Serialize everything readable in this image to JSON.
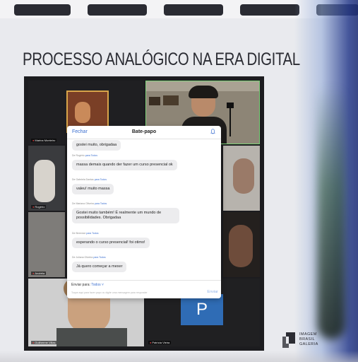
{
  "headline": "PROCESSO ANALÓGICO NA ERA DIGITAL",
  "participants": {
    "marina": "Marina Monteiro",
    "rogerio": "Rogério",
    "andreia": "Andréia",
    "guilherme": "Guilherme Villas",
    "patricia": "Patrícia Vieira",
    "patricia_initial": "P"
  },
  "chat": {
    "close_label": "Fechar",
    "title": "Bate-papo",
    "messages": [
      {
        "meta": "",
        "text": "gostei muito, obrigadaa"
      },
      {
        "meta_from": "De Rogério",
        "meta_to": "para Todos",
        "text": "massa demais quando der fazer um curso presencial ok"
      },
      {
        "meta_from": "De Gabriela Dantas",
        "meta_to": "para Todos",
        "text": "valeu! muito massa"
      },
      {
        "meta_from": "De Mariana Oliveira",
        "meta_to": "para Todos",
        "text": "Gostei muito também! É realmente um mundo de possibilidades. Obrigadaa"
      },
      {
        "meta_from": "De Berenice",
        "meta_to": "para Todos",
        "text": "esperando o curso presencial! foi otimo!"
      },
      {
        "meta_from": "De Juliana Oliveira",
        "meta_to": "para Todos",
        "text": "Já quero começar a mexer"
      }
    ],
    "send_to_label": "Enviar para:",
    "send_to_value": "Todos",
    "input_placeholder": "Toque aqui para fazer papo ou digite uma mensagem para responder",
    "send_label": "Enviar"
  },
  "logo": {
    "line1": "IMAGEM",
    "line2": "BRASIL",
    "line3": "GALERIA"
  },
  "colors": {
    "accent": "#3a6ecf",
    "mic_off": "#e34040",
    "patricia_tile": "#2f6cb5"
  }
}
